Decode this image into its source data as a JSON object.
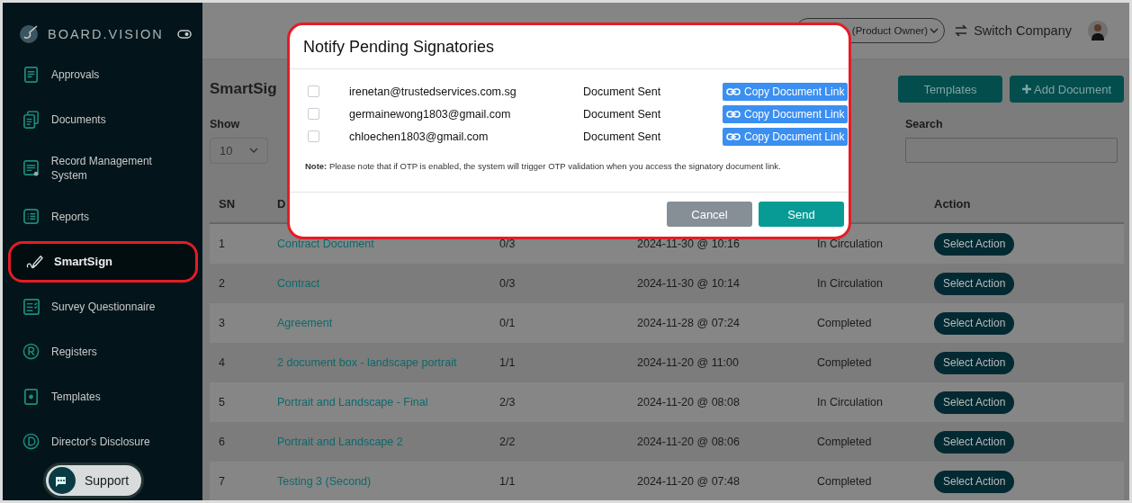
{
  "sidebar": {
    "logo": "BOARD.VISION",
    "items": [
      {
        "label": "Approvals",
        "selected": false
      },
      {
        "label": "Documents",
        "selected": false
      },
      {
        "label": "Record Management System",
        "selected": false
      },
      {
        "label": "Reports",
        "selected": false
      },
      {
        "label": "SmartSign",
        "selected": true
      },
      {
        "label": "Survey Questionnaire",
        "selected": false
      },
      {
        "label": "Registers",
        "selected": false
      },
      {
        "label": "Templates",
        "selected": false
      },
      {
        "label": "Director's Disclosure",
        "selected": false
      }
    ],
    "support": "Support"
  },
  "header": {
    "role_menu": "(Product Owner)",
    "switch_company": "Switch Company"
  },
  "page": {
    "title": "SmartSig",
    "templates_button": "Templates",
    "add_button": "Add Document",
    "show_label": "Show",
    "show_value": "10",
    "search_label": "Search"
  },
  "table": {
    "columns": [
      "SN",
      "D",
      "Action"
    ],
    "rows": [
      {
        "sn": "1",
        "document": "Contract Document",
        "signed": "0/3",
        "date": "2024-11-30 @ 10:16",
        "status": "In Circulation",
        "action": "Select Action"
      },
      {
        "sn": "2",
        "document": "Contract",
        "signed": "0/3",
        "date": "2024-11-30 @ 10:14",
        "status": "In Circulation",
        "action": "Select Action"
      },
      {
        "sn": "3",
        "document": "Agreement",
        "signed": "0/1",
        "date": "2024-11-28 @ 07:24",
        "status": "Completed",
        "action": "Select Action"
      },
      {
        "sn": "4",
        "document": "2 document box - landscape portrait",
        "signed": "1/1",
        "date": "2024-11-20 @ 11:00",
        "status": "Completed",
        "action": "Select Action"
      },
      {
        "sn": "5",
        "document": "Portrait and Landscape - Final",
        "signed": "2/3",
        "date": "2024-11-20 @ 08:08",
        "status": "In Circulation",
        "action": "Select Action"
      },
      {
        "sn": "6",
        "document": "Portrait and Landscape 2",
        "signed": "2/2",
        "date": "2024-11-20 @ 08:06",
        "status": "Completed",
        "action": "Select Action"
      },
      {
        "sn": "7",
        "document": "Testing 3 (Second)",
        "signed": "1/1",
        "date": "2024-11-20 @ 07:48",
        "status": "Completed",
        "action": "Select Action"
      }
    ]
  },
  "modal": {
    "title": "Notify Pending Signatories",
    "signatories": [
      {
        "email": "irenetan@trustedservices.com.sg",
        "status": "Document Sent",
        "checked": false,
        "link_button": "Copy Document Link"
      },
      {
        "email": "germainewong1803@gmail.com",
        "status": "Document Sent",
        "checked": false,
        "link_button": "Copy Document Link"
      },
      {
        "email": "chloechen1803@gmail.com",
        "status": "Document Sent",
        "checked": false,
        "link_button": "Copy Document Link"
      }
    ],
    "note": "**Note:** Please note that if OTP is enabled, the system will trigger OTP validation when you access the signatory document link.",
    "buttons": [
      {
        "label": "Cancel",
        "kind": "secondary"
      },
      {
        "label": "Send",
        "kind": "primary"
      }
    ]
  }
}
